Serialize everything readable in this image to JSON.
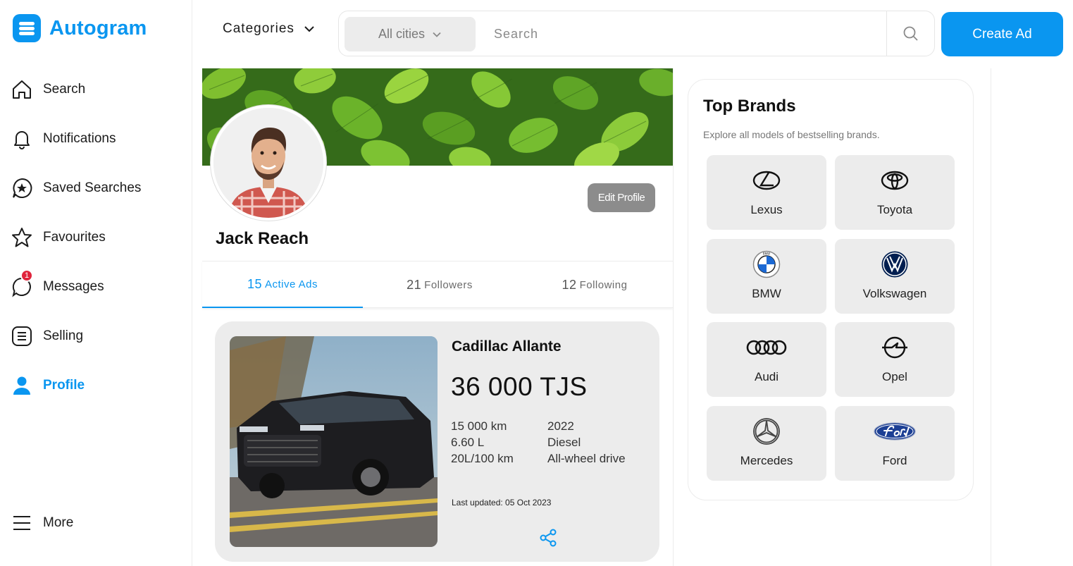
{
  "app": {
    "name": "Autogram",
    "accent": "#0a96f0"
  },
  "sidebar": {
    "items": [
      {
        "label": "Search",
        "icon": "home-icon"
      },
      {
        "label": "Notifications",
        "icon": "bell-icon"
      },
      {
        "label": "Saved Searches",
        "icon": "star-chat-icon"
      },
      {
        "label": "Favourites",
        "icon": "star-icon"
      },
      {
        "label": "Messages",
        "icon": "chat-bubble-icon",
        "badge": "1"
      },
      {
        "label": "Selling",
        "icon": "selling-icon"
      },
      {
        "label": "Profile",
        "icon": "user-icon",
        "active": true
      }
    ],
    "more": {
      "label": "More",
      "icon": "menu-icon"
    }
  },
  "topbar": {
    "categories_label": "Categories",
    "city_label": "All cities",
    "search_placeholder": "Search",
    "create_label": "Create Ad"
  },
  "profile": {
    "name": "Jack Reach",
    "edit_label": "Edit Profile",
    "tabs": [
      {
        "count": "15",
        "label": "Active Ads",
        "active": true
      },
      {
        "count": "21",
        "label": "Followers"
      },
      {
        "count": "12",
        "label": "Following"
      }
    ]
  },
  "ad": {
    "title": "Cadillac Allante",
    "price": "36 000 TJS",
    "mileage": "15 000 km",
    "engine": "6.60 L",
    "consumption": "20L/100 km",
    "year": "2022",
    "fuel": "Diesel",
    "drive": "All-wheel drive",
    "updated": "Last updated: 05 Oct 2023"
  },
  "brands": {
    "title": "Top Brands",
    "subtitle": "Explore all models of bestselling brands.",
    "items": [
      {
        "name": "Lexus",
        "icon": "lexus-logo-icon"
      },
      {
        "name": "Toyota",
        "icon": "toyota-logo-icon"
      },
      {
        "name": "BMW",
        "icon": "bmw-logo-icon"
      },
      {
        "name": "Volkswagen",
        "icon": "volkswagen-logo-icon"
      },
      {
        "name": "Audi",
        "icon": "audi-logo-icon"
      },
      {
        "name": "Opel",
        "icon": "opel-logo-icon"
      },
      {
        "name": "Mercedes",
        "icon": "mercedes-logo-icon"
      },
      {
        "name": "Ford",
        "icon": "ford-logo-icon"
      }
    ]
  }
}
